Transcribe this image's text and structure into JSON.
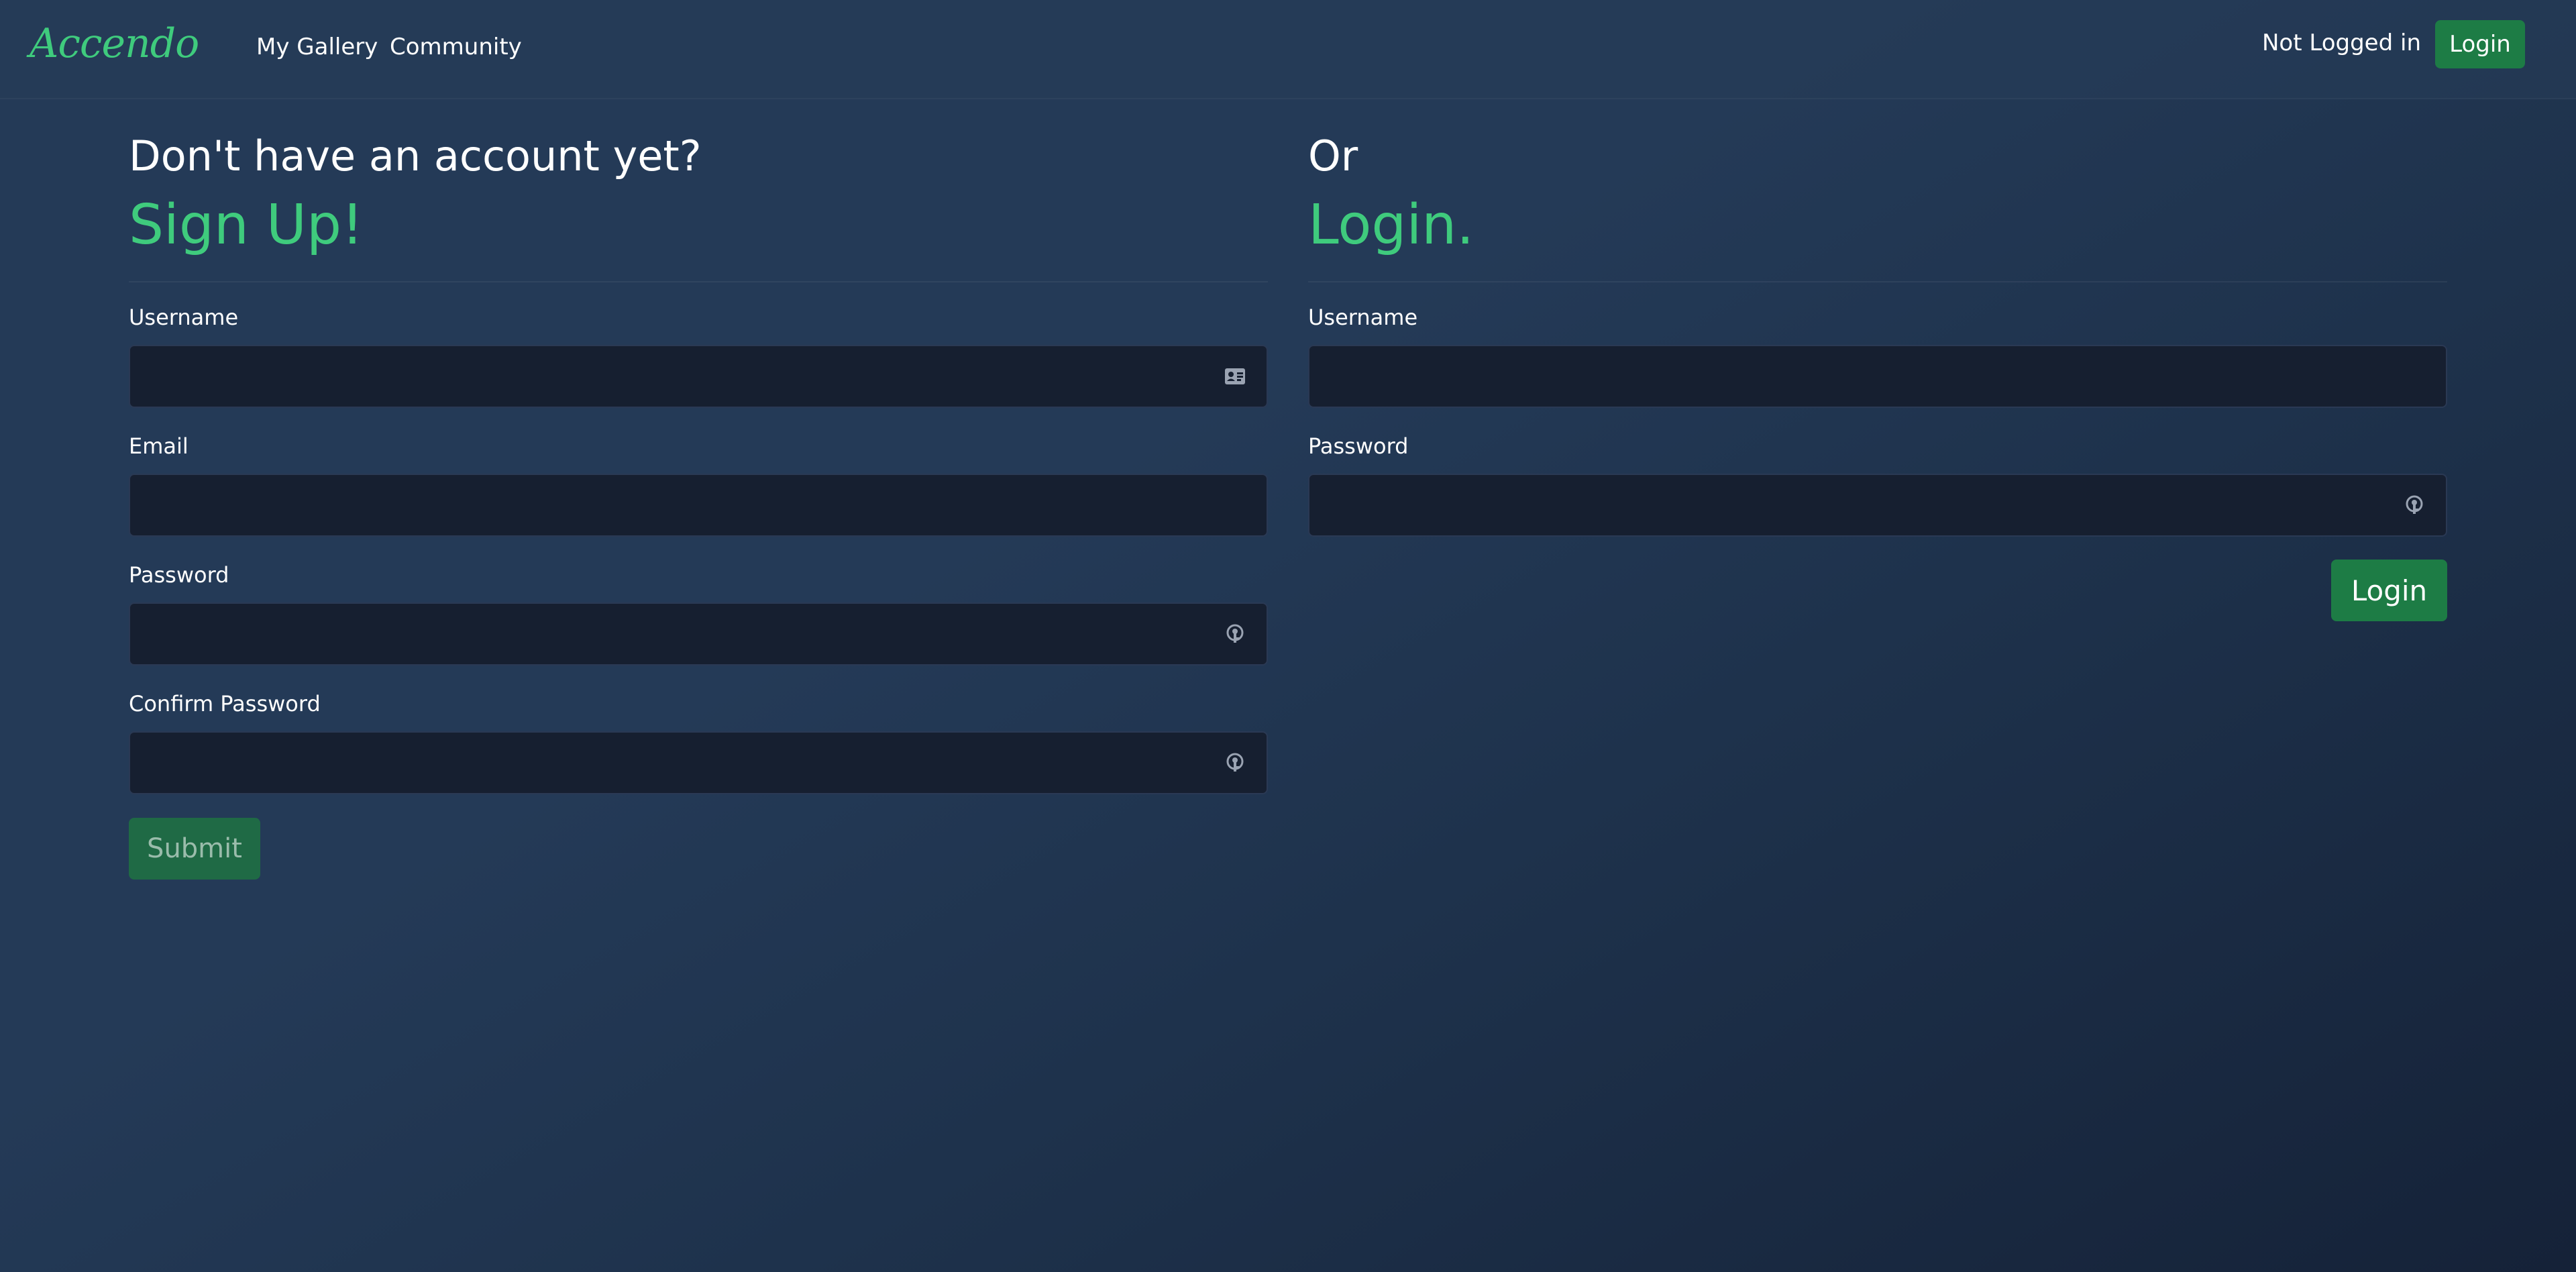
{
  "colors": {
    "accent_green": "#3fcb7d",
    "button_green": "#1d7c45",
    "field_bg": "#161f30",
    "page_bg": "#243a57"
  },
  "navbar": {
    "brand": "Accendo",
    "links": [
      "My Gallery",
      "Community"
    ],
    "status": "Not Logged in",
    "login_label": "Login"
  },
  "signup": {
    "heading_small": "Don't have an account yet?",
    "heading_big": "Sign Up!",
    "fields": [
      {
        "label": "Username",
        "value": "",
        "icon": "contact-card-icon"
      },
      {
        "label": "Email",
        "value": ""
      },
      {
        "label": "Password",
        "value": "",
        "icon": "key-icon"
      },
      {
        "label": "Confirm Password",
        "value": "",
        "icon": "key-icon"
      }
    ],
    "submit_label": "Submit"
  },
  "login": {
    "heading_small": "Or",
    "heading_big": "Login.",
    "fields": [
      {
        "label": "Username",
        "value": ""
      },
      {
        "label": "Password",
        "value": "",
        "icon": "key-icon"
      }
    ],
    "submit_label": "Login"
  }
}
